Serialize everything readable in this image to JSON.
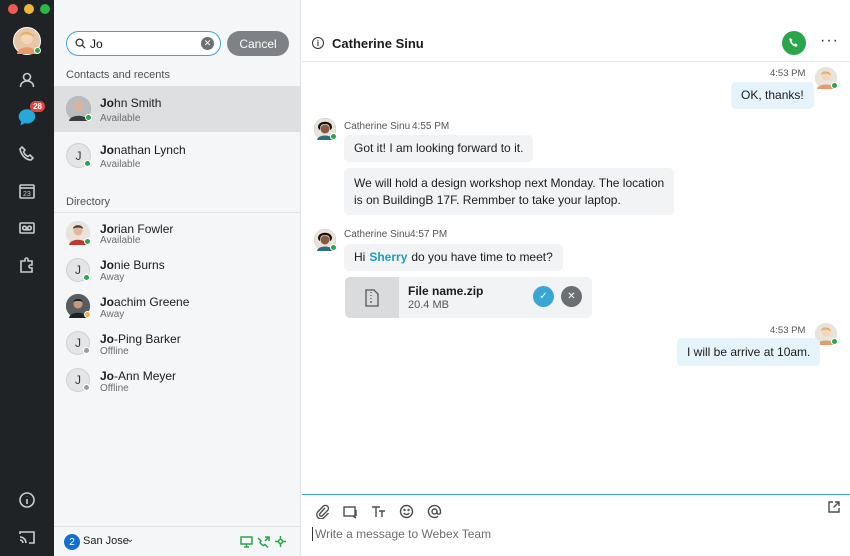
{
  "window": {
    "traffic_lights": [
      "#ee5a52",
      "#f2b53c",
      "#2bb645"
    ]
  },
  "rail": {
    "unread_badge": "28"
  },
  "search": {
    "value": "Jo",
    "cancel_label": "Cancel"
  },
  "sections": {
    "contacts_label": "Contacts and recents",
    "directory_label": "Directory"
  },
  "contacts": [
    {
      "match": "Jo",
      "rest": "hn Smith",
      "status": "Available",
      "initial": "",
      "status_color": "#2aa64a"
    },
    {
      "match": "Jo",
      "rest": "nathan Lynch",
      "status": "Available",
      "initial": "J",
      "status_color": "#2aa64a"
    }
  ],
  "directory": [
    {
      "match": "Jo",
      "rest": "rian Fowler",
      "status": "Available",
      "initial": "",
      "status_color": "#2aa64a"
    },
    {
      "match": "Jo",
      "rest": "nie Burns",
      "status": "Away",
      "initial": "J",
      "status_color": "#2aa64a"
    },
    {
      "match": "Jo",
      "rest": "achim Greene",
      "status": "Away",
      "initial": "",
      "status_color": "#f2b53c"
    },
    {
      "match": "Jo",
      "rest": "-Ping Barker",
      "status": "Offline",
      "initial": "J",
      "status_color": "#9a9da0"
    },
    {
      "match": "Jo",
      "rest": "-Ann Meyer",
      "status": "Offline",
      "initial": "J",
      "status_color": "#9a9da0"
    }
  ],
  "footer": {
    "location_number": "2",
    "location_label": "San Jose"
  },
  "chat": {
    "title": "Catherine Sinu",
    "messages": {
      "m1_time": "4:53 PM",
      "m1_text": "OK, thanks!",
      "m2_sender": "Catherine Sinu",
      "m2_time": "4:55 PM",
      "m2_text": "Got it! I am looking forward to it.",
      "m3_line1": "We will hold a design workshop next Monday. The location",
      "m3_line2": "is on BuildingB 17F. Remmber to take your laptop.",
      "m4_sender": "Catherine Sinu",
      "m4_time": "4:57 PM",
      "m4_prefix": "Hi",
      "m4_mention": "Sherry",
      "m4_suffix": "do you have time to meet?",
      "m5_time": "4:53 PM",
      "m5_text": "I will be arrive at 10am."
    },
    "file": {
      "name": "File name.zip",
      "size": "20.4 MB"
    },
    "composer_placeholder": "Write a message to Webex Team"
  }
}
